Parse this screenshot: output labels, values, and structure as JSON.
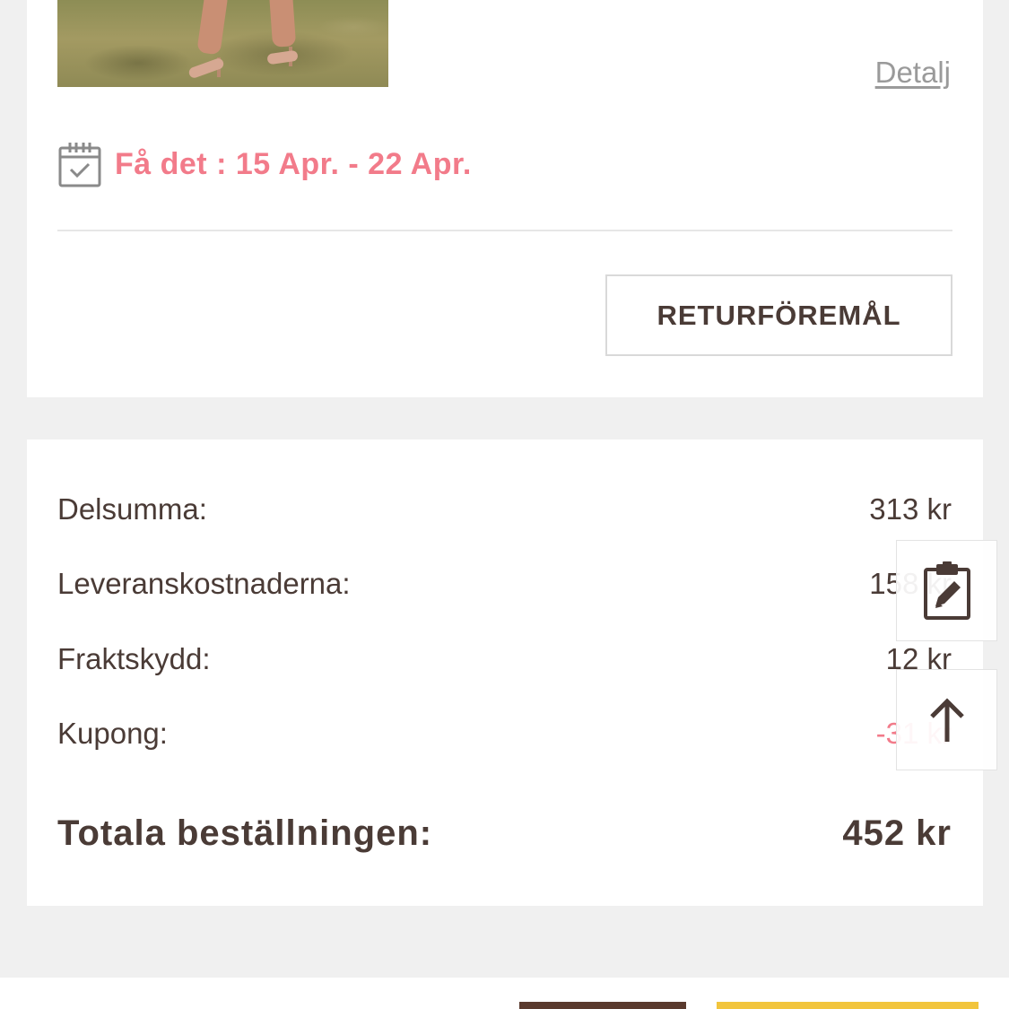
{
  "product": {
    "detail_link": "Detalj",
    "image_icon": "product-photo"
  },
  "delivery": {
    "icon": "calendar-check-icon",
    "text": "Få det : 15 Apr. - 22 Apr."
  },
  "actions": {
    "return_button": "RETURFÖREMÅL"
  },
  "summary": {
    "rows": [
      {
        "label": "Delsumma:",
        "value": "313 kr"
      },
      {
        "label": "Leveranskostnaderna:",
        "value": "158 kr"
      },
      {
        "label": "Fraktskydd:",
        "value": "12 kr"
      },
      {
        "label": "Kupong:",
        "value": "-31 kr"
      }
    ],
    "total_label": "Totala beställningen:",
    "total_value": "452 kr"
  },
  "floating": {
    "edit_icon": "clipboard-edit-icon",
    "top_icon": "arrow-up-icon"
  },
  "colors": {
    "accent_pink": "#f27b8a",
    "text_brown": "#4a3b36",
    "button_dark": "#5a3a2e",
    "button_yellow": "#f2c53d",
    "background": "#f0f0f0"
  }
}
